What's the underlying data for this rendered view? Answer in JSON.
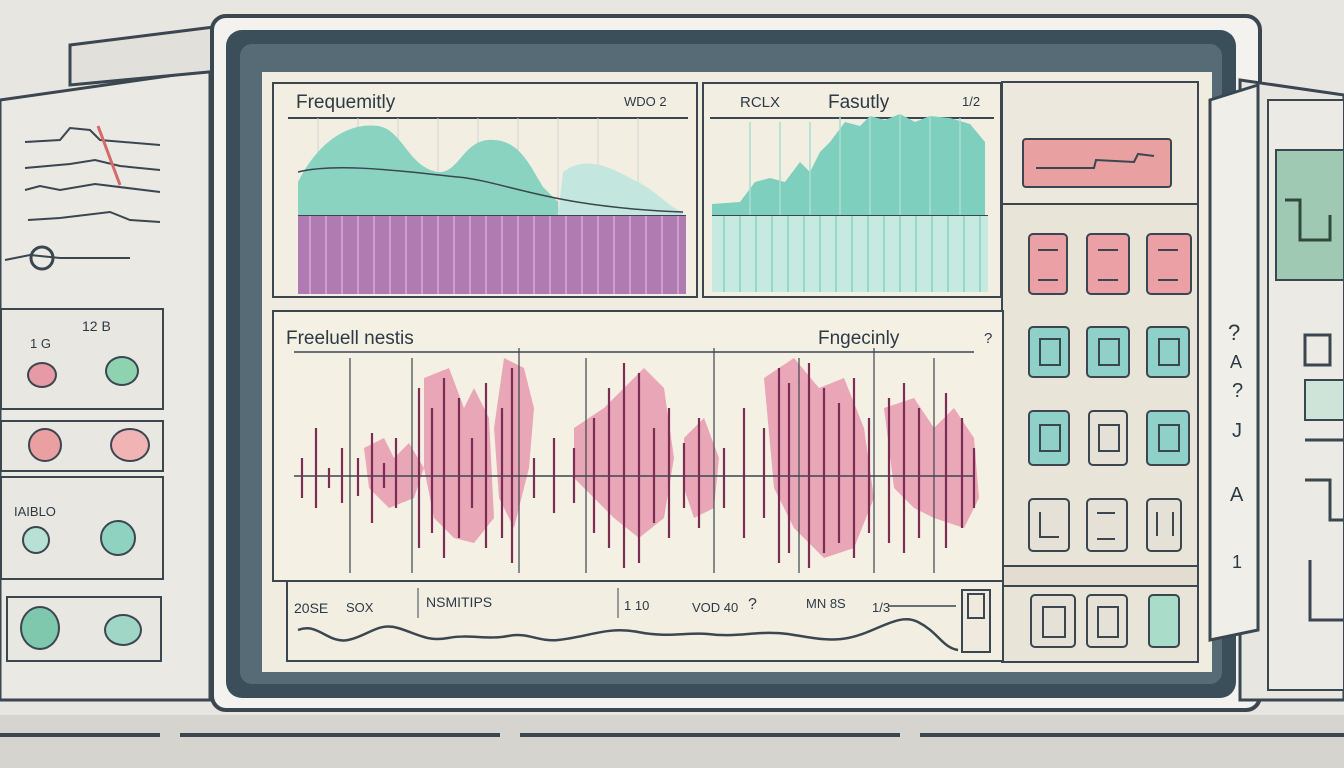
{
  "colors": {
    "background": "#e8e6e1",
    "bezel": "#3b4f5a",
    "screen": "#f1ece0",
    "teal": "#7fcfbe",
    "pink": "#e79ab0",
    "purple": "#b07ab3",
    "ink": "#2c3a44"
  },
  "left_panel": {
    "box1": {
      "label_a": "12 B",
      "label_b": "1 G"
    },
    "box3": {
      "label": "IAIBLO"
    }
  },
  "top_left_chart": {
    "title": "Frequemitly",
    "corner": "WDO 2",
    "icons": [
      "teal-area",
      "purple-bars"
    ]
  },
  "top_right_chart": {
    "label_left": "RCLX",
    "title": "Fasutly",
    "corner": "1/2"
  },
  "main_chart": {
    "title": "Freeluell nestis",
    "right_label": "Fngecinly",
    "corner": "?"
  },
  "bottom_strip": {
    "labels": [
      "20SE",
      "SOX",
      "NSMITIPS",
      "1 10",
      "VOD 40",
      "?",
      "MN 8S",
      "1/3"
    ]
  },
  "right_tower": {
    "glyphs": [
      "?",
      "A",
      "?",
      "J",
      "A",
      "1"
    ]
  }
}
